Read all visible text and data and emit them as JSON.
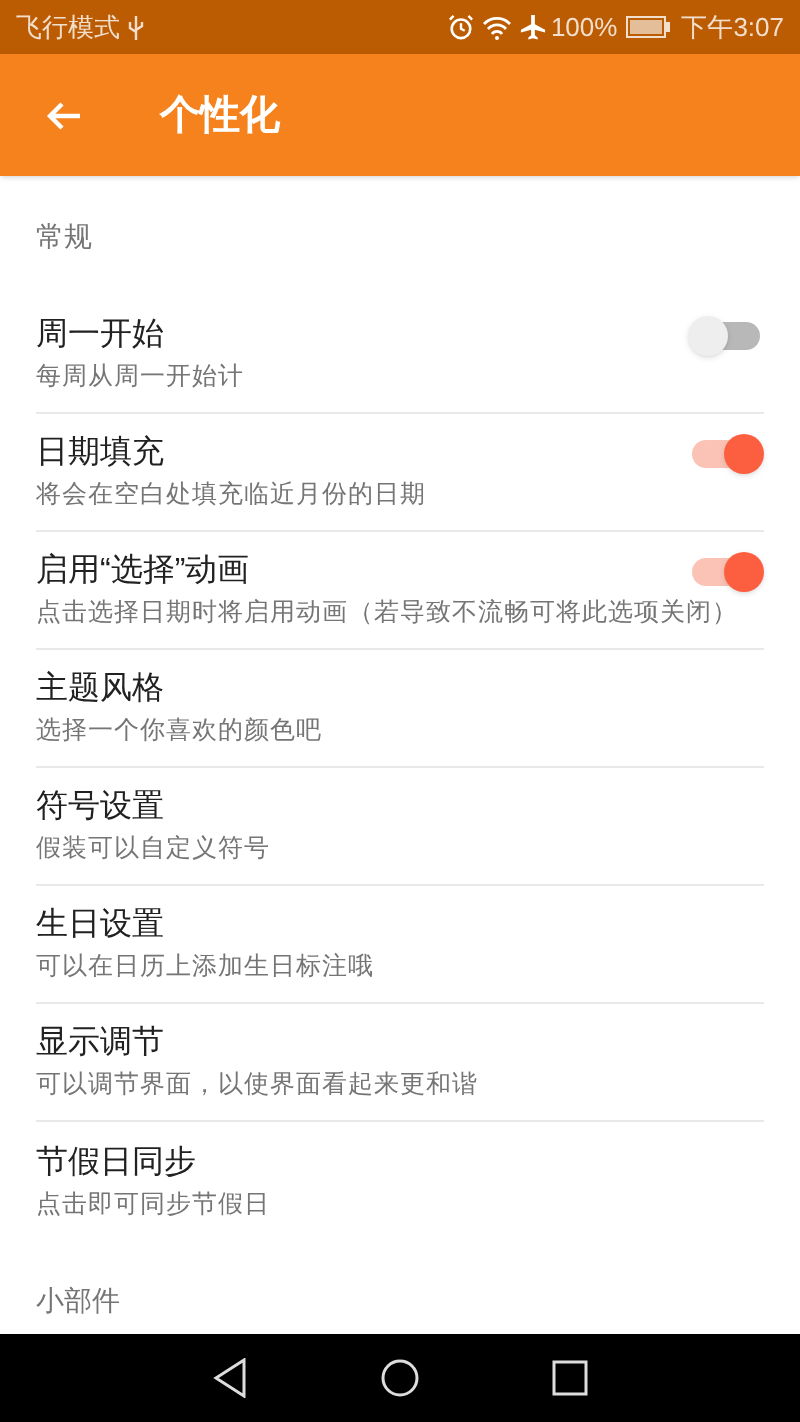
{
  "status_bar": {
    "left": "飞行模式",
    "battery": "100%",
    "time": "下午3:07"
  },
  "app_bar": {
    "title": "个性化"
  },
  "sections": [
    {
      "header": "常规",
      "items": [
        {
          "title": "周一开始",
          "subtitle": "每周从周一开始计",
          "kind": "switch",
          "on": false
        },
        {
          "title": "日期填充",
          "subtitle": "将会在空白处填充临近月份的日期",
          "kind": "switch",
          "on": true
        },
        {
          "title": "启用“选择”动画",
          "subtitle": "点击选择日期时将启用动画（若导致不流畅可将此选项关闭）",
          "kind": "switch",
          "on": true
        },
        {
          "title": "主题风格",
          "subtitle": "选择一个你喜欢的颜色吧",
          "kind": "plain"
        },
        {
          "title": "符号设置",
          "subtitle": "假装可以自定义符号",
          "kind": "plain"
        },
        {
          "title": "生日设置",
          "subtitle": "可以在日历上添加生日标注哦",
          "kind": "plain"
        },
        {
          "title": "显示调节",
          "subtitle": "可以调节界面，以使界面看起来更和谐",
          "kind": "plain"
        },
        {
          "title": "节假日同步",
          "subtitle": "点击即可同步节假日",
          "kind": "plain"
        }
      ]
    },
    {
      "header": "小部件"
    }
  ]
}
